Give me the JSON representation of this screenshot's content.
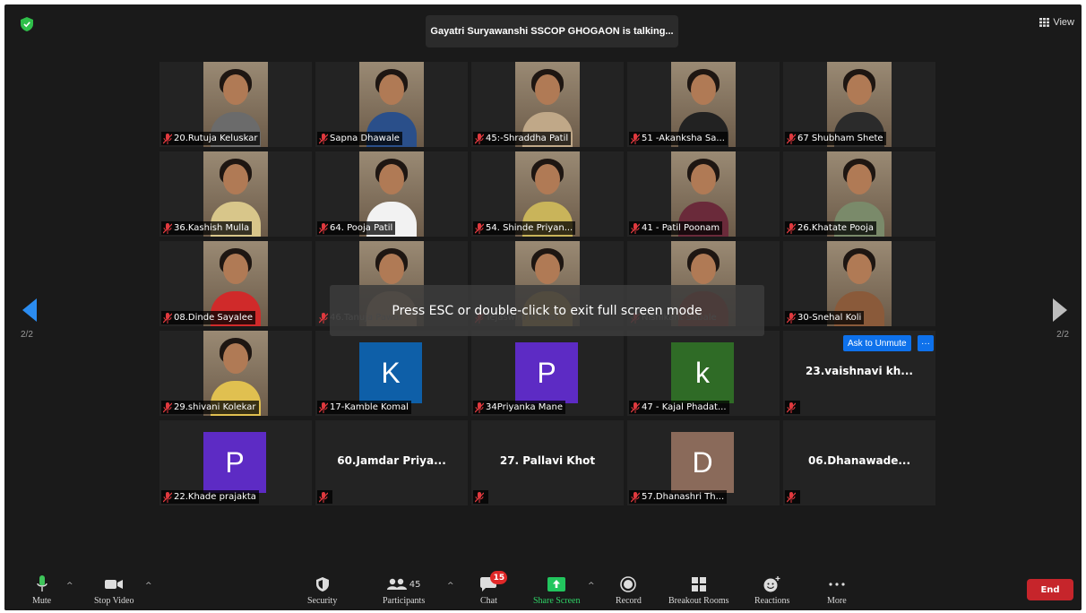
{
  "speaker_banner": "Gayatri Suryawanshi SSCOP GHOGAON is talking...",
  "view_label": "View",
  "fullscreen_toast": "Press ESC or double-click to exit full screen mode",
  "pager": {
    "left": "2/2",
    "right": "2/2"
  },
  "ask_unmute": {
    "label": "Ask to Unmute",
    "more": "···"
  },
  "colors": {
    "avatar_blue": "#0e5fa8",
    "avatar_purple": "#5d2bc4",
    "avatar_green": "#2f6b26",
    "avatar_tan": "#8a6a5a",
    "end_red": "#c6252b",
    "accent_blue": "#0e71eb",
    "mic_red": "#e0393e",
    "share_green": "#22c55e"
  },
  "participants": [
    {
      "name": "20.Rutuja Keluskar",
      "kind": "video",
      "shirt": "#6b6b6b"
    },
    {
      "name": "Sapna Dhawale",
      "kind": "video",
      "shirt": "#2a4f8a"
    },
    {
      "name": "45:-Shraddha Patil",
      "kind": "video",
      "shirt": "#c0a888"
    },
    {
      "name": "51 -Akanksha Sa...",
      "kind": "video",
      "shirt": "#222222"
    },
    {
      "name": "67 Shubham Shete",
      "kind": "video",
      "shirt": "#2b2b2b"
    },
    {
      "name": "36.Kashish Mulla",
      "kind": "video",
      "shirt": "#d8c68a"
    },
    {
      "name": "64. Pooja Patil",
      "kind": "video",
      "shirt": "#f2f2f2"
    },
    {
      "name": "54. Shinde Priyan...",
      "kind": "video",
      "shirt": "#c9b45a"
    },
    {
      "name": "41  - Patil Poonam",
      "kind": "video",
      "shirt": "#6a2a3a"
    },
    {
      "name": "26.Khatate Pooja",
      "kind": "video",
      "shirt": "#7a8a6a"
    },
    {
      "name": "08.Dinde Sayalee",
      "kind": "video",
      "shirt": "#d02a2a"
    },
    {
      "name": "46.Tanuja Pawar",
      "kind": "video",
      "shirt": "#b89a7a",
      "ghost": true
    },
    {
      "name": "Tejaswini Kharat",
      "kind": "video",
      "shirt": "#caa050",
      "ghost": true
    },
    {
      "name": "Nishikant Sabale",
      "kind": "video",
      "shirt": "#a04030",
      "ghost": true
    },
    {
      "name": "30-Snehal Koli",
      "kind": "video",
      "shirt": "#8a5a3a"
    },
    {
      "name": "29.shivani Kolekar",
      "kind": "video",
      "shirt": "#e0c050"
    },
    {
      "name": "17-Kamble Komal",
      "kind": "avatar",
      "letter": "K",
      "color": "#0e5fa8"
    },
    {
      "name": "34Priyanka Mane",
      "kind": "avatar",
      "letter": "P",
      "color": "#5d2bc4"
    },
    {
      "name": "47 - Kajal Phadat...",
      "kind": "avatar",
      "letter": "k",
      "color": "#2f6b26"
    },
    {
      "name": "",
      "kind": "text",
      "display": "23.vaishnavi  kh..."
    },
    {
      "name": "22.Khade prajakta",
      "kind": "avatar",
      "letter": "P",
      "color": "#5d2bc4"
    },
    {
      "name": "",
      "kind": "text",
      "display": "60.Jamdar  Priya..."
    },
    {
      "name": "",
      "kind": "text",
      "display": "27. Pallavi Khot"
    },
    {
      "name": "57.Dhanashri Th...",
      "kind": "avatar",
      "letter": "D",
      "color": "#8a6a5a"
    },
    {
      "name": "",
      "kind": "text",
      "display": "06.Dhanawade..."
    }
  ],
  "toolbar": {
    "mute": "Mute",
    "stop_video": "Stop Video",
    "security": "Security",
    "participants": "Participants",
    "participants_count": "45",
    "chat": "Chat",
    "chat_badge": "15",
    "share_screen": "Share Screen",
    "record": "Record",
    "breakout_rooms": "Breakout Rooms",
    "reactions": "Reactions",
    "more": "More",
    "end": "End"
  }
}
